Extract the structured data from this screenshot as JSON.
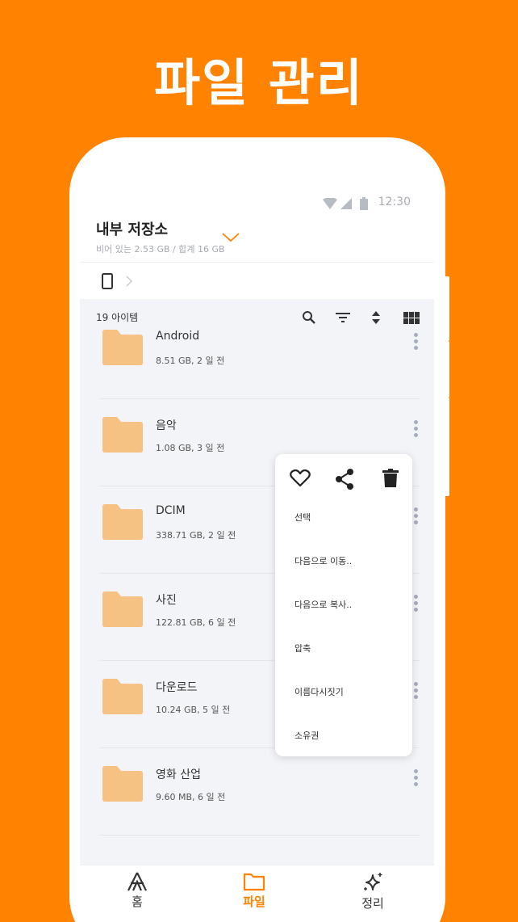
{
  "promo": {
    "title": "파일 관리"
  },
  "status_bar": {
    "time": "12:30"
  },
  "storage": {
    "title": "내부 저장소",
    "subtitle": "비어 있는 2.53 GB / 합계 16 GB"
  },
  "list": {
    "count_label": "19 아이템",
    "items": [
      {
        "name": "Android",
        "meta": "8.51 GB, 2 일 전"
      },
      {
        "name": "음악",
        "meta": "1.08 GB, 3 일 전"
      },
      {
        "name": "DCIM",
        "meta": "338.71 GB, 2 일 전"
      },
      {
        "name": "사진",
        "meta": "122.81 GB, 6 일 전"
      },
      {
        "name": "다운로드",
        "meta": "10.24 GB, 5 일 전"
      },
      {
        "name": "영화 산업",
        "meta": "9.60 MB, 6 일 전"
      }
    ]
  },
  "context_menu": {
    "items": [
      "선택",
      "다음으로 이동..",
      "다음으로 복사..",
      "압축",
      "이름다시짓기",
      "소유권"
    ]
  },
  "bottom_nav": {
    "home": "홈",
    "files": "파일",
    "clean": "정리"
  },
  "colors": {
    "brand": "#FF8200",
    "folder": "#F5C283",
    "background": "#f3f4f7"
  }
}
